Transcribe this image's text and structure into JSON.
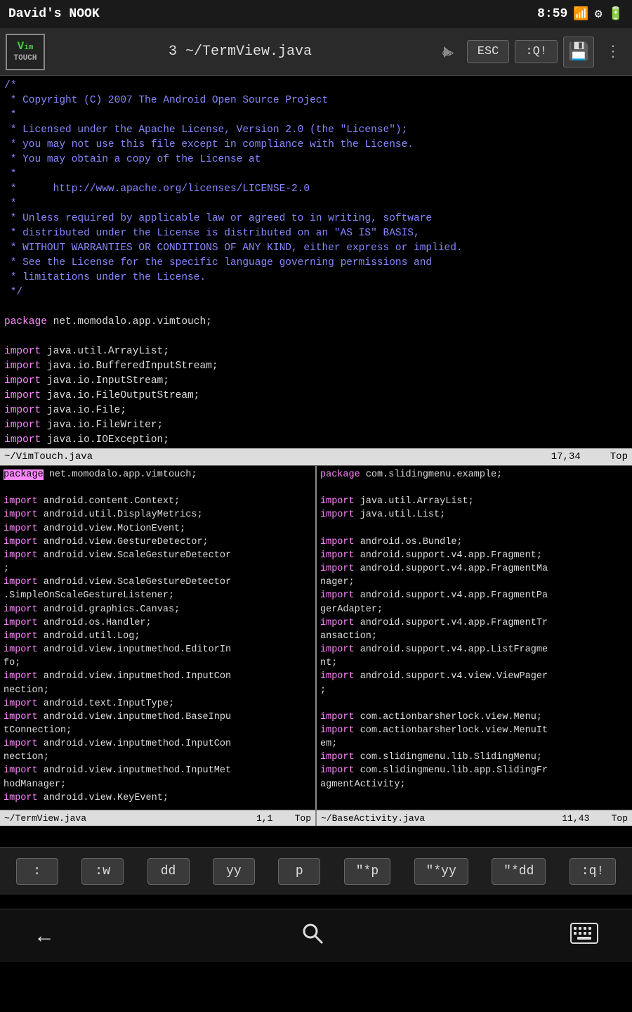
{
  "status_bar": {
    "title": "David's NOOK",
    "time": "8:59",
    "icons": [
      "wifi",
      "settings",
      "battery"
    ]
  },
  "toolbar": {
    "file_title": "3 ~/TermView.java",
    "esc_label": "ESC",
    "quit_label": ":Q!",
    "vim_top": "Vim",
    "vim_bottom": "TOUCH"
  },
  "shortcuts": {
    "items": [
      ":",
      ":w",
      "dd",
      "yy",
      "p",
      "\"*p",
      "\"*yy",
      "\"*dd",
      ":q!"
    ]
  },
  "bottom_nav": {
    "back": "←",
    "search": "🔍",
    "keyboard": "⌨"
  },
  "main_code": {
    "status_left": "~/VimTouch.java",
    "status_pos": "17,34",
    "status_top": "Top",
    "split_left_status_file": "~/TermView.java",
    "split_left_status_pos": "1,1",
    "split_left_status_top": "Top",
    "split_right_status_file": "~/BaseActivity.java",
    "split_right_status_pos": "11,43",
    "split_right_status_top": "Top"
  }
}
